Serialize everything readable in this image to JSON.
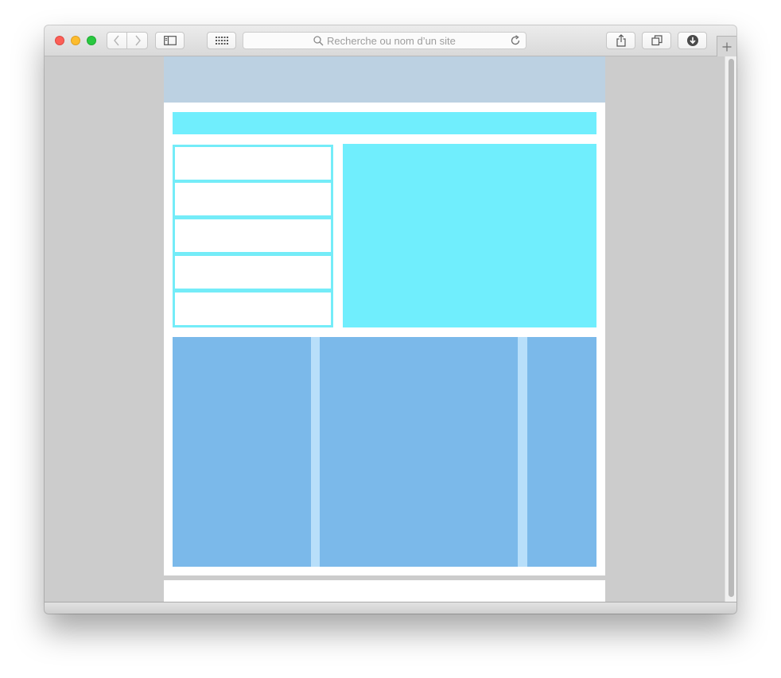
{
  "browser": {
    "address_placeholder": "Recherche ou nom d’un site",
    "icons": {
      "close": "close-icon",
      "minimize": "minimize-icon",
      "zoom": "zoom-icon",
      "back": "chevron-left-icon",
      "forward": "chevron-right-icon",
      "sidebar": "sidebar-icon",
      "top_sites": "grid-icon",
      "search": "search-icon",
      "reload": "reload-icon",
      "share": "share-icon",
      "tabs": "tabs-overview-icon",
      "downloads": "download-icon",
      "new_tab": "plus-icon"
    }
  },
  "colors": {
    "header": "#bcd1e2",
    "accent_cyan": "#70eefd",
    "column_blue": "#7bb9ea",
    "column_gutter": "#b8dffa",
    "page_background": "#cccccc"
  },
  "page": {
    "list_items": 5,
    "columns": 3
  }
}
